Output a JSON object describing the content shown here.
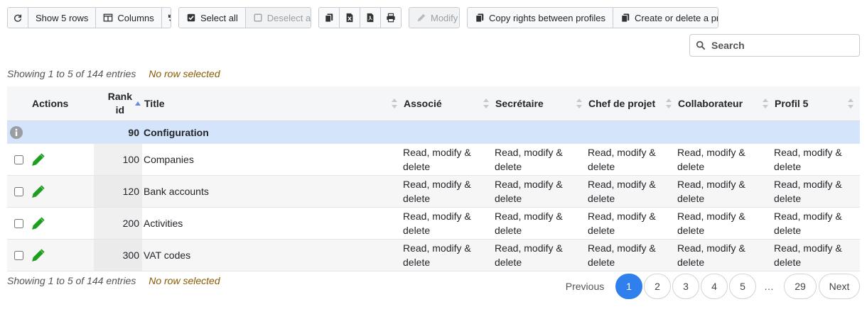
{
  "toolbar": {
    "refresh_icon": "refresh-icon",
    "show_rows_label": "Show 5 rows",
    "columns_label": "Columns",
    "reset_icon": "undo-icon",
    "select_all_label": "Select all",
    "deselect_all_label": "Deselect all",
    "export_icons": [
      "copy-icon",
      "excel-icon",
      "pdf-icon",
      "print-icon"
    ],
    "modify_label": "Modify",
    "copy_rights_label": "Copy rights between profiles",
    "create_delete_label": "Create or delete a profile"
  },
  "search": {
    "placeholder": "Search"
  },
  "info_top": {
    "showing": "Showing 1 to 5 of 144 entries",
    "selection": "No row selected"
  },
  "info_bottom": {
    "showing": "Showing 1 to 5 of 144 entries",
    "selection": "No row selected"
  },
  "table": {
    "headers": {
      "actions": "Actions",
      "rank_line1": "Rank",
      "rank_line2": "id",
      "title": "Title",
      "associe": "Associé",
      "secretaire": "Secrétaire",
      "chef": "Chef de projet",
      "collaborateur": "Collaborateur",
      "profil5": "Profil 5"
    },
    "group": {
      "rank": "90",
      "title": "Configuration"
    },
    "rows": [
      {
        "rank": "100",
        "title": "Companies",
        "perm_line1": "Read, modify &",
        "perm_line2": "delete"
      },
      {
        "rank": "120",
        "title": "Bank accounts",
        "perm_line1": "Read, modify &",
        "perm_line2": "delete"
      },
      {
        "rank": "200",
        "title": "Activities",
        "perm_line1": "Read, modify &",
        "perm_line2": "delete"
      },
      {
        "rank": "300",
        "title": "VAT codes",
        "perm_line1": "Read, modify &",
        "perm_line2": "delete"
      }
    ]
  },
  "pagination": {
    "previous": "Previous",
    "pages": [
      "1",
      "2",
      "3",
      "4",
      "5"
    ],
    "ellipsis": "…",
    "last": "29",
    "next": "Next",
    "current": "1"
  },
  "colors": {
    "accent": "#2f80ed",
    "group_row": "#d4e4fa",
    "edit_icon": "#1e9e1e",
    "selection_text": "#8a5a00"
  }
}
